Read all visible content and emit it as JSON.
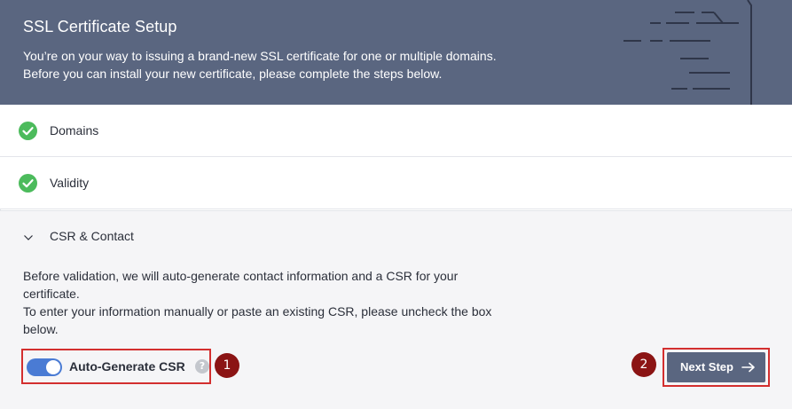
{
  "header": {
    "title": "SSL Certificate Setup",
    "description_line1": "You’re on your way to issuing a brand-new SSL certificate for one or multiple domains.",
    "description_line2": "Before you can install your new certificate, please complete the steps below."
  },
  "steps": [
    {
      "label": "Domains",
      "status": "complete",
      "icon": "check-circle-icon"
    },
    {
      "label": "Validity",
      "status": "complete",
      "icon": "check-circle-icon"
    }
  ],
  "csr": {
    "title": "CSR & Contact",
    "expanded": true,
    "desc_line1": "Before validation, we will auto-generate contact information and a CSR for your",
    "desc_line2": "certificate.",
    "desc_line3": "To enter your information manually or paste an existing CSR, please uncheck the box",
    "desc_line4": "below.",
    "toggle_label": "Auto-Generate CSR",
    "toggle_on": true,
    "help_glyph": "?"
  },
  "actions": {
    "next_label": "Next Step"
  },
  "annotations": {
    "badge1": "1",
    "badge2": "2"
  },
  "colors": {
    "header_bg": "#5a6680",
    "check_green": "#4cbb5c",
    "toggle_blue": "#4a7bd4",
    "highlight_red": "#d32f2f",
    "badge_red": "#8b1414",
    "button_bg": "#5a6680"
  }
}
